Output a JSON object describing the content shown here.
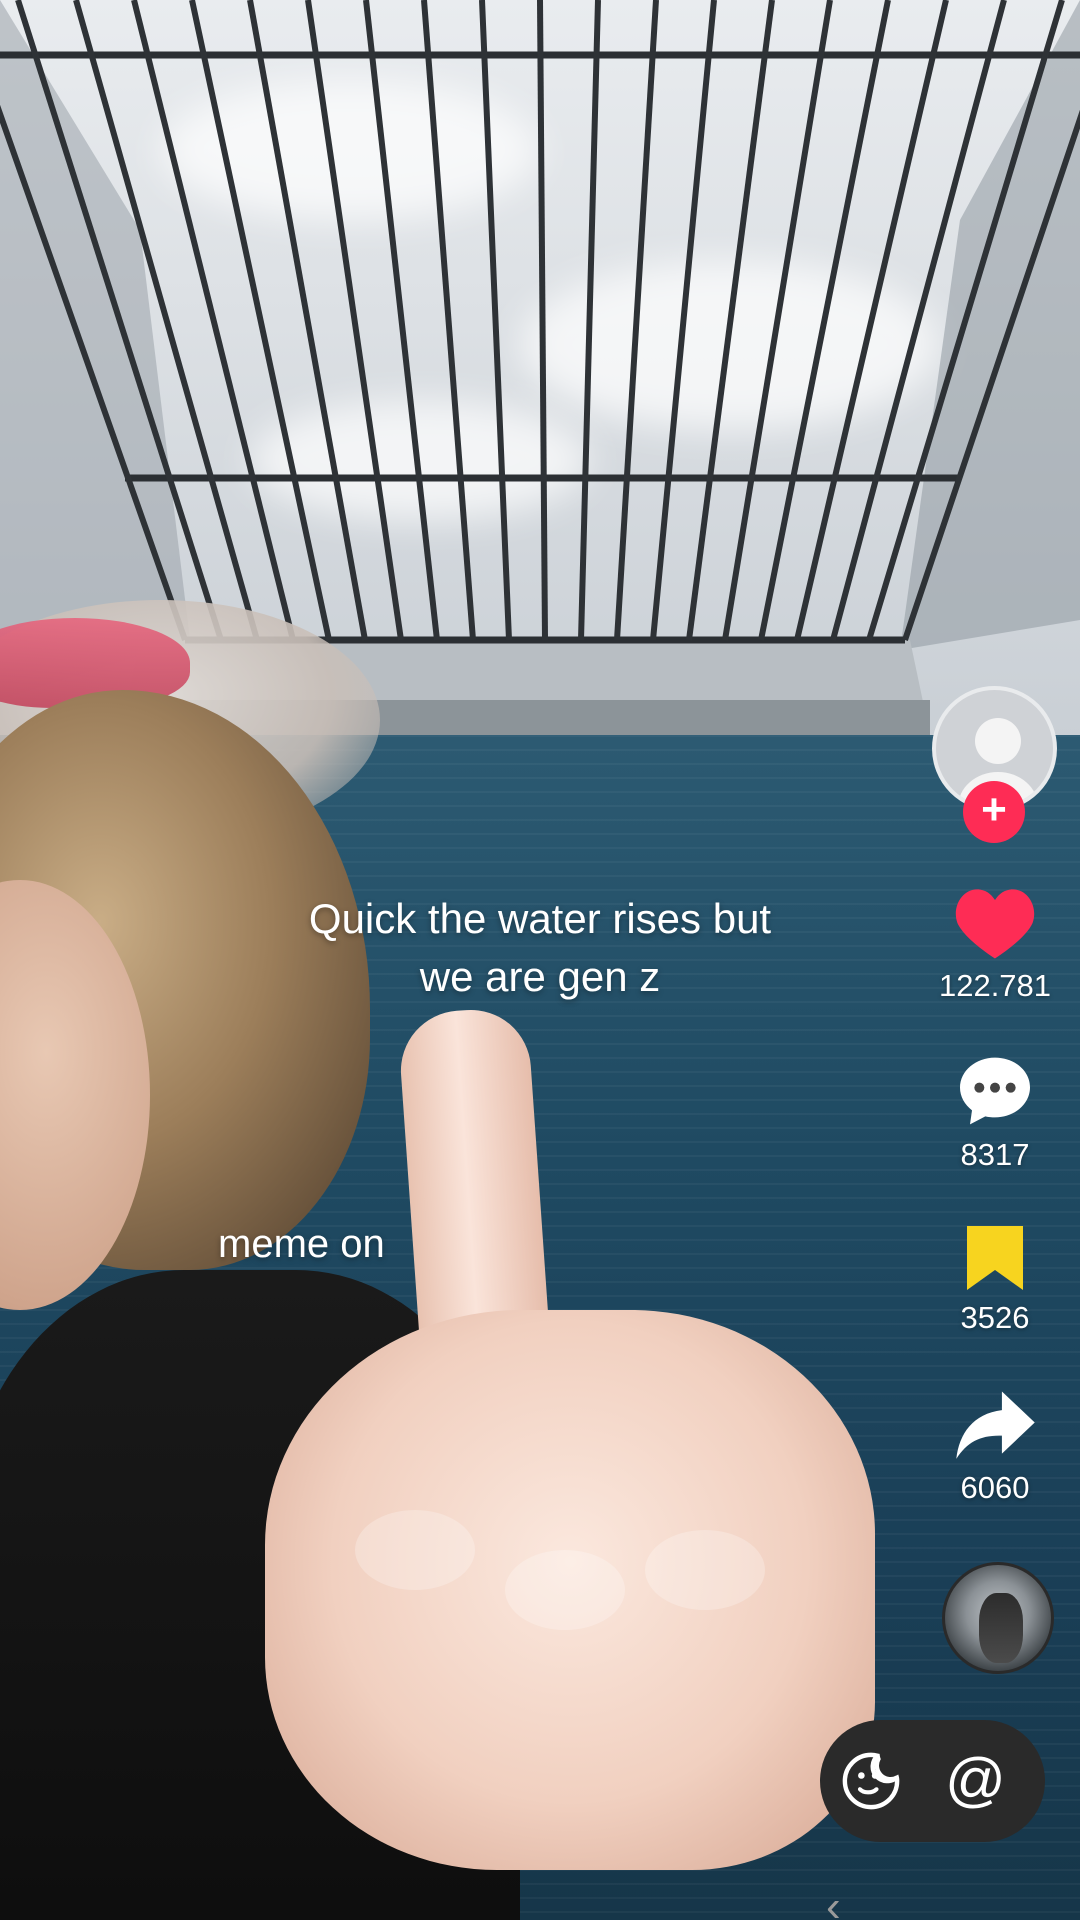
{
  "video": {
    "caption_line1": "Quick the water rises but",
    "caption_line2": "we are gen z",
    "overlay_text": "meme on"
  },
  "creator": {
    "follow_label": "+"
  },
  "actions": {
    "likes": "122.781",
    "comments": "8317",
    "saves": "3526",
    "shares": "6060"
  },
  "icons": {
    "like": "heart-icon",
    "comment": "comment-bubble-icon",
    "save": "bookmark-icon",
    "share": "share-arrow-icon",
    "emoji": "emoji-sticker-icon",
    "mention": "at-icon",
    "back": "chevron-left-icon"
  },
  "comment_bar": {
    "mention_symbol": "@",
    "back_symbol": "‹"
  },
  "colors": {
    "like": "#fe2c55",
    "save": "#f7d41f",
    "follow": "#fe2c55"
  }
}
